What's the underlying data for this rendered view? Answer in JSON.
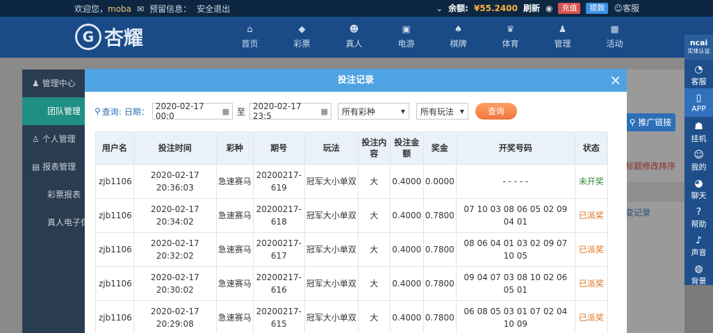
{
  "topbar": {
    "welcome": "欢迎您，",
    "username": "moba",
    "notice_label": "预留信息：",
    "logout": "安全退出",
    "balance_label": "余额:",
    "balance": "¥55.2400",
    "refresh": "刷新",
    "recharge": "充值",
    "withdraw": "提款",
    "service": "客服"
  },
  "header": {
    "logo_text": "杏耀",
    "nav": [
      {
        "label": "首页",
        "icon": "home-icon"
      },
      {
        "label": "彩票",
        "icon": "lottery-icon"
      },
      {
        "label": "真人",
        "icon": "live-icon"
      },
      {
        "label": "电游",
        "icon": "slot-icon"
      },
      {
        "label": "棋牌",
        "icon": "cards-icon"
      },
      {
        "label": "体育",
        "icon": "trophy-icon"
      },
      {
        "label": "管理",
        "icon": "users-icon"
      },
      {
        "label": "活动",
        "icon": "gift-icon"
      }
    ]
  },
  "rightbar": {
    "badge_top": "ncai",
    "badge_sub": "实体认证",
    "items": [
      {
        "label": "客服",
        "icon": "chat-icon"
      },
      {
        "label": "APP",
        "icon": "phone-icon"
      },
      {
        "label": "挂机",
        "icon": "robot-icon"
      },
      {
        "label": "我的",
        "icon": "user-icon"
      },
      {
        "label": "聊天",
        "icon": "message-icon"
      },
      {
        "label": "帮助",
        "icon": "help-icon"
      },
      {
        "label": "声音",
        "icon": "sound-icon"
      },
      {
        "label": "背景",
        "icon": "palette-icon"
      }
    ]
  },
  "sidemenu": {
    "items": [
      {
        "label": "管理中心"
      },
      {
        "label": "团队管理"
      },
      {
        "label": "个人管理"
      },
      {
        "label": "报表管理"
      },
      {
        "label": "彩票报表"
      },
      {
        "label": "真人电子保"
      }
    ]
  },
  "background": {
    "promo_button": "推广链接",
    "link1": "标题修改排序",
    "link2": "变记录"
  },
  "modal": {
    "title": "投注记录",
    "close": "×",
    "query_label": "查询:",
    "date_label": "日期：",
    "date_from": "2020-02-17 00:0",
    "to_label": "至",
    "date_to": "2020-02-17 23:5",
    "lottery_select": "所有彩种",
    "play_select": "所有玩法",
    "query_button": "查询"
  },
  "table": {
    "headers": [
      "用户名",
      "投注时间",
      "彩种",
      "期号",
      "玩法",
      "投注内容",
      "投注金额",
      "奖金",
      "开奖号码",
      "状态"
    ],
    "rows": [
      {
        "user": "zjb1106",
        "time": "2020-02-17 20:36:03",
        "lottery": "急速赛马",
        "issue": "20200217-619",
        "play": "冠军大小单双",
        "content": "大",
        "amount": "0.4000",
        "bonus": "0.0000",
        "numbers": "- - - - -",
        "status": "未开奖"
      },
      {
        "user": "zjb1106",
        "time": "2020-02-17 20:34:02",
        "lottery": "急速赛马",
        "issue": "20200217-618",
        "play": "冠军大小单双",
        "content": "大",
        "amount": "0.4000",
        "bonus": "0.7800",
        "numbers": "07 10 03 08 06 05 02 09 04 01",
        "status": "已派奖"
      },
      {
        "user": "zjb1106",
        "time": "2020-02-17 20:32:02",
        "lottery": "急速赛马",
        "issue": "20200217-617",
        "play": "冠军大小单双",
        "content": "大",
        "amount": "0.4000",
        "bonus": "0.7800",
        "numbers": "08 06 04 01 03 02 09 07 10 05",
        "status": "已派奖"
      },
      {
        "user": "zjb1106",
        "time": "2020-02-17 20:30:02",
        "lottery": "急速赛马",
        "issue": "20200217-616",
        "play": "冠军大小单双",
        "content": "大",
        "amount": "0.4000",
        "bonus": "0.7800",
        "numbers": "09 04 07 03 08 10 02 06 05 01",
        "status": "已派奖"
      },
      {
        "user": "zjb1106",
        "time": "2020-02-17 20:29:08",
        "lottery": "急速赛马",
        "issue": "20200217-615",
        "play": "冠军大小单双",
        "content": "大",
        "amount": "0.4000",
        "bonus": "0.7800",
        "numbers": "06 08 05 03 01 07 02 04 10 09",
        "status": "已派奖"
      }
    ]
  },
  "colors": {
    "modal_header": "#4fa3e3",
    "status_pending": "#2f8c2f",
    "status_paid": "#e0701c",
    "query_button": "#f0753c"
  }
}
